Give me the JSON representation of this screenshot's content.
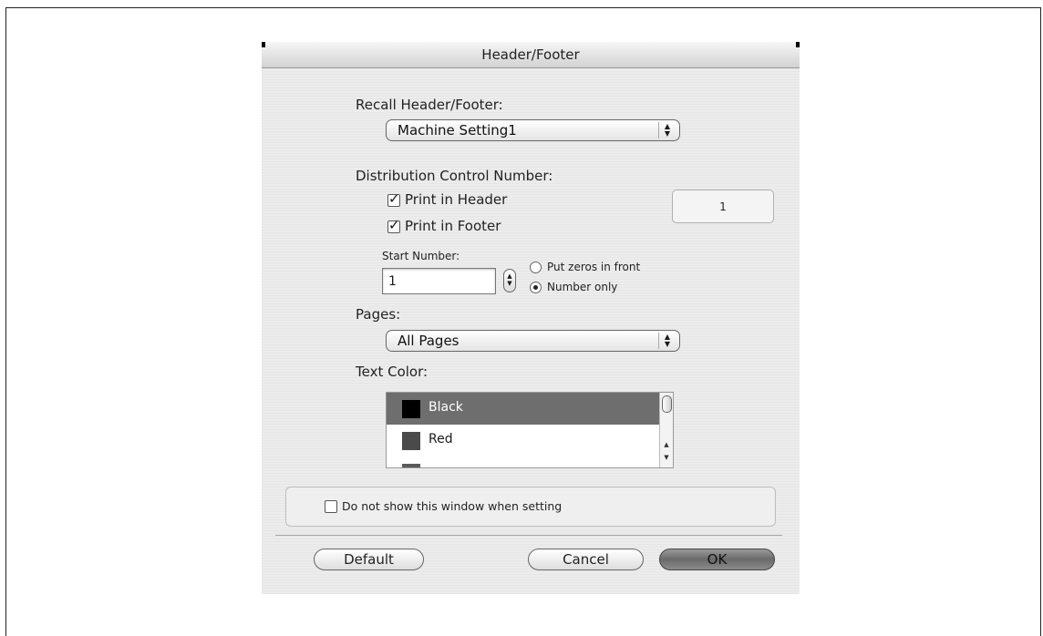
{
  "window": {
    "title": "Header/Footer"
  },
  "recall": {
    "label": "Recall Header/Footer:",
    "selected": "Machine Setting1"
  },
  "distribution": {
    "label": "Distribution Control Number:",
    "print_header": {
      "label": "Print in Header",
      "checked": true
    },
    "print_footer": {
      "label": "Print in Footer",
      "checked": true
    },
    "preview_value": "1",
    "start_number_label": "Start Number:",
    "start_number_value": "1",
    "radio_zeros": {
      "label": "Put zeros in front",
      "selected": false
    },
    "radio_number_only": {
      "label": "Number only",
      "selected": true
    }
  },
  "pages": {
    "label": "Pages:",
    "selected": "All Pages"
  },
  "text_color": {
    "label": "Text Color:",
    "items": [
      {
        "label": "Black",
        "swatch": "#000000",
        "selected": true
      },
      {
        "label": "Red",
        "swatch": "#4a4a4a",
        "selected": false
      },
      {
        "label": "",
        "swatch": "#5a5a5a",
        "selected": false
      }
    ]
  },
  "dont_show": {
    "label": "Do not show this window when setting",
    "checked": false
  },
  "buttons": {
    "default": "Default",
    "cancel": "Cancel",
    "ok": "OK"
  },
  "icons": {
    "popup": "updown-arrows-icon",
    "checkmark": "checkmark-icon"
  }
}
